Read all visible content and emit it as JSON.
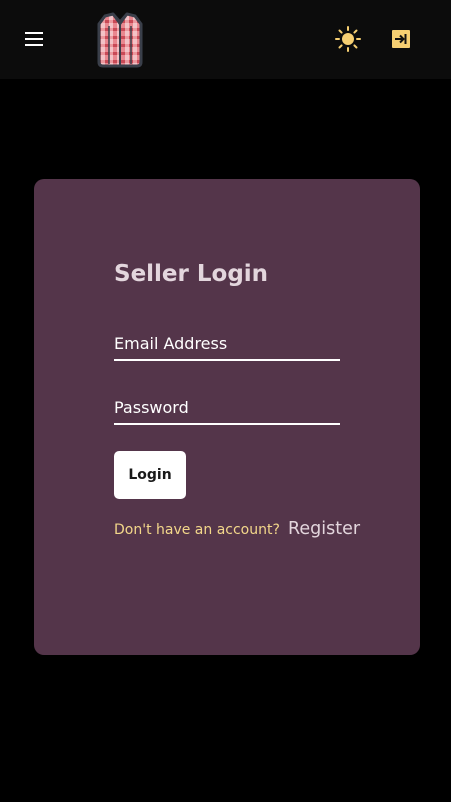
{
  "header": {
    "menu_icon": "hamburger-menu-icon",
    "logo_icon": "shirt-logo-icon",
    "theme_icon": "sun-icon",
    "login_icon": "sign-in-icon",
    "accent_color": "#f6cf72"
  },
  "card": {
    "title": "Seller Login",
    "background_color": "#54354a",
    "email": {
      "placeholder": "Email Address",
      "value": ""
    },
    "password": {
      "placeholder": "Password",
      "value": ""
    },
    "login_label": "Login",
    "register_prompt": "Don't have an account?",
    "register_link": "Register"
  }
}
